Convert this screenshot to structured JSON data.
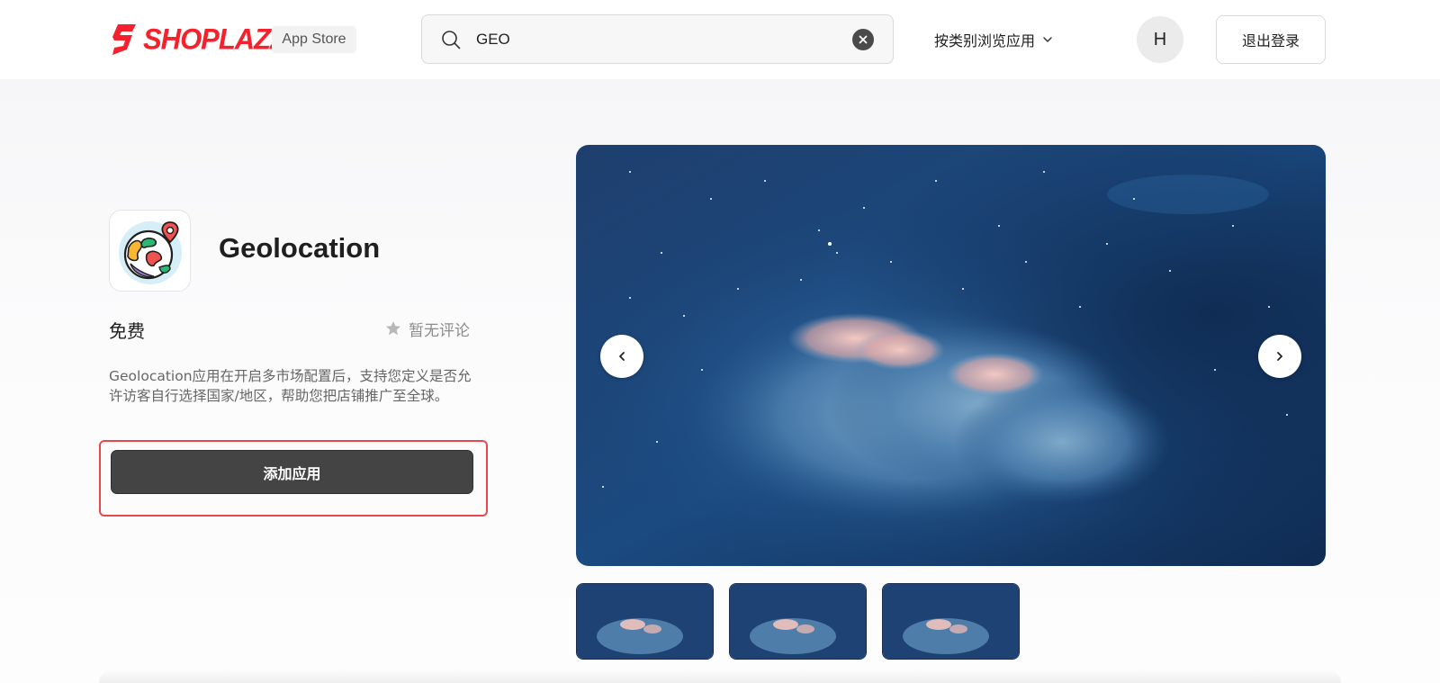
{
  "header": {
    "logo_text": "SHOPLAZZA",
    "store_badge": "App Store",
    "search": {
      "value": "GEO",
      "placeholder": ""
    },
    "browse_label": "按类别浏览应用",
    "avatar_initial": "H",
    "logout_label": "退出登录"
  },
  "app": {
    "name": "Geolocation",
    "price": "免费",
    "reviews": "暂无评论",
    "description": "Geolocation应用在开启多市场配置后，支持您定义是否允许访客自行选择国家/地区，帮助您把店铺推广至全球。",
    "add_button": "添加应用"
  },
  "carousel": {
    "image_count": 3,
    "active_index": 0
  },
  "colors": {
    "brand": "#f5222d",
    "button": "#444444",
    "highlight": "#e5484d"
  }
}
